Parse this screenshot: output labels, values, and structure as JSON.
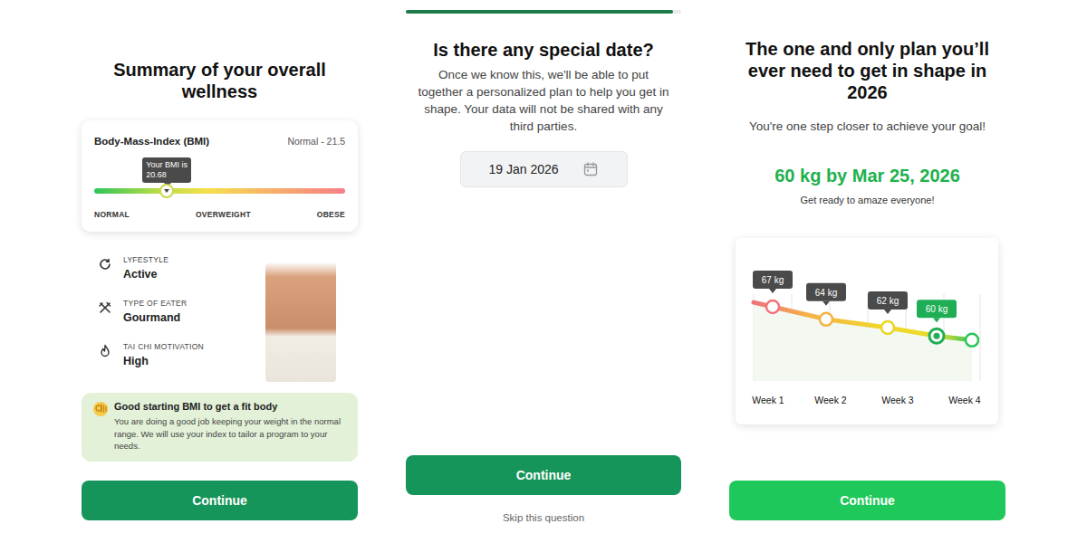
{
  "summary": {
    "title": "Summary of your overall wellness",
    "bmi": {
      "label": "Body-Mass-Index (BMI)",
      "reference": "Normal - 21.5",
      "tooltip": "Your BMI is 20.68",
      "level": 0.29,
      "scale": [
        "NORMAL",
        "OVERWEIGHT",
        "OBESE"
      ]
    },
    "stats": [
      {
        "label": "LYFESTYLE",
        "value": "Active"
      },
      {
        "label": "TYPE OF EATER",
        "value": "Gourmand"
      },
      {
        "label": "TAI CHI MOTIVATION",
        "value": "High"
      }
    ],
    "tip": {
      "title": "Good starting BMI to get a fit body",
      "text": "You are doing a good job keeping your weight in the normal range. We will use your index to tailor a program to your needs."
    },
    "button": "Continue"
  },
  "special_date": {
    "progress": {
      "level": 0.97
    },
    "title": "Is there any special date?",
    "description": "Once we know this, we'll be able to put together a personalized plan to help you get in shape. Your data will not be shared with any third parties.",
    "date": "19 Jan 2026",
    "button": "Continue",
    "skip": "Skip this question"
  },
  "plan": {
    "title": "The one and only plan you’ll ever need to get in shape in 2026",
    "subtitle": "You're one step closer to achieve your goal!",
    "goal": "60 kg by Mar 25, 2026",
    "goal_note": "Get ready to amaze everyone!",
    "chart": {
      "points": [
        {
          "value": 67,
          "label": "67 kg",
          "color": "#f0737b",
          "selected": false
        },
        {
          "value": 64,
          "label": "64 kg",
          "color": "#f4b345",
          "selected": false
        },
        {
          "value": 62,
          "label": "62 kg",
          "color": "#e9d526",
          "selected": false
        },
        {
          "value": 60,
          "label": "60 kg",
          "color": "#1fae55",
          "selected": true
        },
        {
          "value": 59,
          "color": "#2cc45c",
          "selected": false
        }
      ],
      "weeks": [
        "Week 1",
        "Week 2",
        "Week 3",
        "Week 4"
      ]
    },
    "button": "Continue"
  }
}
